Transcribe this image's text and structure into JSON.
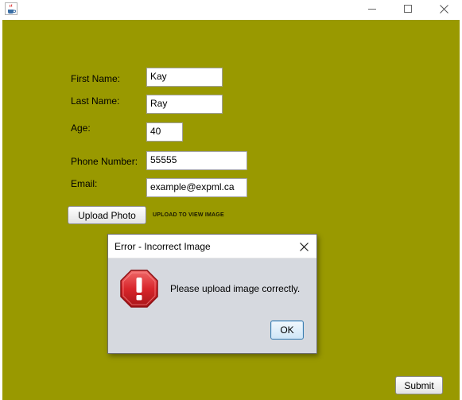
{
  "window": {
    "icon": "java-cup-icon",
    "controls": [
      "minimize-icon",
      "maximize-icon",
      "close-icon"
    ]
  },
  "form": {
    "first_name_label": "First Name:",
    "first_name_value": "Kay",
    "last_name_label": "Last Name:",
    "last_name_value": "Ray",
    "age_label": "Age:",
    "age_value": "40",
    "phone_label": "Phone Number:",
    "phone_value": "55555",
    "email_label": "Email:",
    "email_value": "example@expml.ca",
    "upload_button_label": "Upload Photo",
    "upload_hint": "UPLOAD TO VIEW IMAGE",
    "submit_button_label": "Submit"
  },
  "dialog": {
    "title": "Error - Incorrect Image",
    "message": "Please upload image correctly.",
    "ok_label": "OK",
    "icon": "error-octagon-icon"
  },
  "colors": {
    "background": "#999900",
    "error_icon": "#d9262b"
  }
}
